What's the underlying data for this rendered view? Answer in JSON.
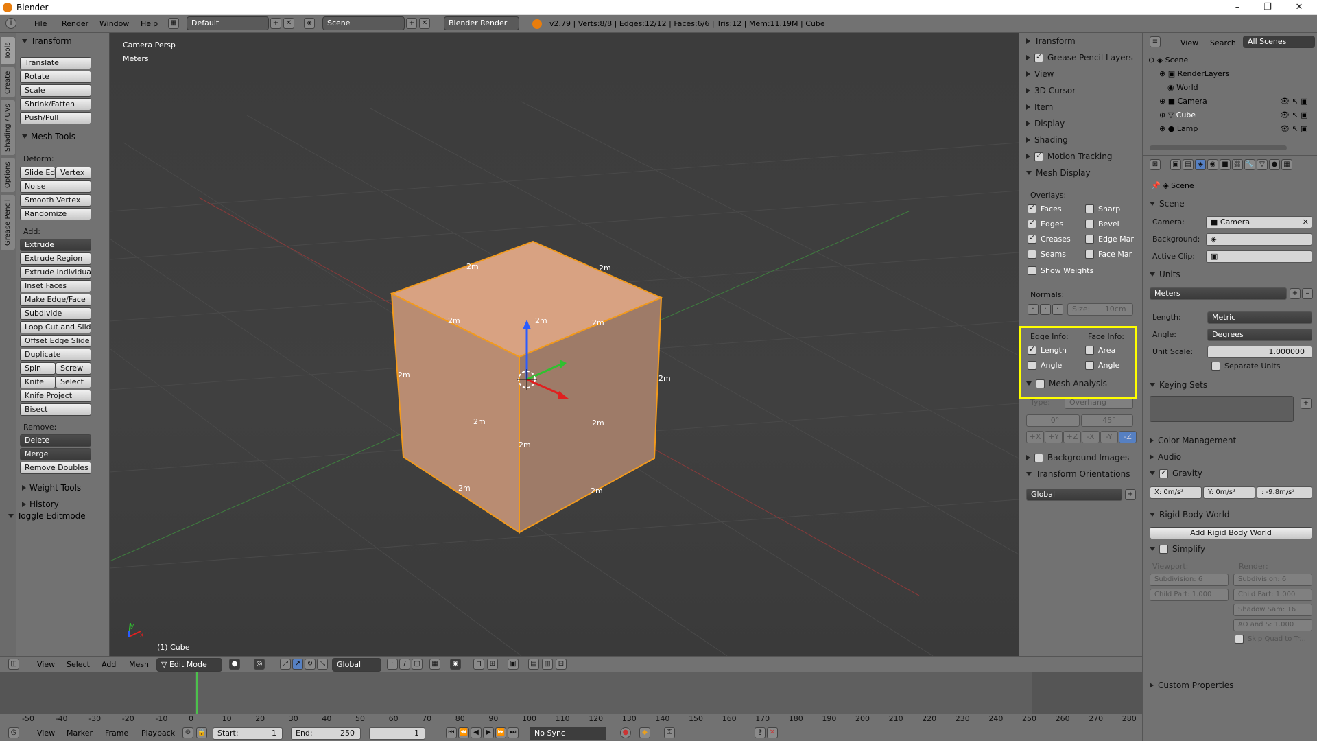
{
  "window": {
    "title": "Blender",
    "minimize": "–",
    "maximize": "❐",
    "close": "✕"
  },
  "menu": {
    "file": "File",
    "render": "Render",
    "window": "Window",
    "help": "Help"
  },
  "header": {
    "screen_layout": "Default",
    "scene": "Scene",
    "engine": "Blender Render",
    "stats": "v2.79 | Verts:8/8 | Edges:12/12 | Faces:6/6 | Tris:12 | Mem:11.19M | Cube"
  },
  "left_tabs": [
    "Tools",
    "Create",
    "Shading / UVs",
    "Options",
    "Grease Pencil"
  ],
  "toolshelf": {
    "transform_header": "Transform",
    "transform_buttons": [
      "Translate",
      "Rotate",
      "Scale",
      "Shrink/Fatten",
      "Push/Pull"
    ],
    "mesh_tools_header": "Mesh Tools",
    "deform_label": "Deform:",
    "slide_edge": "Slide Ed",
    "vertex": "Vertex",
    "noise": "Noise",
    "smooth_vertex": "Smooth Vertex",
    "randomize": "Randomize",
    "add_label": "Add:",
    "extrude": "Extrude",
    "extrude_region": "Extrude Region",
    "extrude_individual": "Extrude Individual",
    "inset_faces": "Inset Faces",
    "make_edge_face": "Make Edge/Face",
    "subdivide": "Subdivide",
    "loop_cut": "Loop Cut and Slide",
    "offset_edge": "Offset Edge Slide",
    "duplicate": "Duplicate",
    "spin": "Spin",
    "screw": "Screw",
    "knife": "Knife",
    "select": "Select",
    "knife_project": "Knife Project",
    "bisect": "Bisect",
    "remove_label": "Remove:",
    "delete": "Delete",
    "merge": "Merge",
    "remove_doubles": "Remove Doubles",
    "weight_tools": "Weight Tools",
    "history": "History",
    "toggle_editmode": "Toggle Editmode"
  },
  "viewport": {
    "view_name": "Camera Persp",
    "units": "Meters",
    "object_label": "(1) Cube",
    "edge_length": "2m",
    "axis_y": "y",
    "axis_x": "x"
  },
  "npanel": {
    "transform": "Transform",
    "grease_pencil_layers": "Grease Pencil Layers",
    "view": "View",
    "cursor_3d": "3D Cursor",
    "item": "Item",
    "display": "Display",
    "shading": "Shading",
    "motion_tracking": "Motion Tracking",
    "mesh_display": "Mesh Display",
    "overlays": "Overlays:",
    "faces": "Faces",
    "sharp": "Sharp",
    "edges": "Edges",
    "bevel": "Bevel",
    "creases": "Creases",
    "edge_mar": "Edge Mar",
    "seams": "Seams",
    "face_mar": "Face Mar",
    "show_weights": "Show Weights",
    "normals": "Normals:",
    "size": "Size:",
    "size_value": "10cm",
    "edge_info": "Edge Info:",
    "face_info": "Face Info:",
    "length": "Length",
    "area": "Area",
    "angle": "Angle",
    "face_angle": "Angle",
    "mesh_analysis": "Mesh Analysis",
    "type_label": "Type:",
    "type_value": "Overhang",
    "min_val": "0°",
    "max_val": "45°",
    "axes": [
      "+X",
      "+Y",
      "+Z",
      "-X",
      "-Y",
      "-Z"
    ],
    "background_images": "Background Images",
    "transform_orientations": "Transform Orientations",
    "global": "Global"
  },
  "outliner": {
    "view": "View",
    "search": "Search",
    "all_scenes": "All Scenes",
    "items": [
      "Scene",
      "RenderLayers",
      "World",
      "Camera",
      "Cube",
      "Lamp"
    ]
  },
  "properties": {
    "breadcrumb": "Scene",
    "scene_header": "Scene",
    "camera_label": "Camera:",
    "camera_value": "Camera",
    "background_label": "Background:",
    "active_clip_label": "Active Clip:",
    "units_header": "Units",
    "units_preset": "Meters",
    "length_label": "Length:",
    "length_value": "Metric",
    "angle_label": "Angle:",
    "angle_value": "Degrees",
    "unit_scale_label": "Unit Scale:",
    "unit_scale_value": "1.000000",
    "separate_units": "Separate Units",
    "keying_sets": "Keying Sets",
    "color_management": "Color Management",
    "audio": "Audio",
    "gravity": "Gravity",
    "gx": "X:  0m/s²",
    "gy": "Y:  0m/s²",
    "gz": ": -9.8m/s²",
    "rigid_body_world": "Rigid Body World",
    "add_rigid_body_world": "Add Rigid Body World",
    "simplify": "Simplify",
    "viewport_label": "Viewport:",
    "render_label": "Render:",
    "subdivision": "Subdivision:",
    "subdivision_value": "6",
    "child_part": "Child Part: 1.000",
    "shadow_sam": "Shadow Sam: 16",
    "ao_and_s": "AO and S: 1.000",
    "skip_quad": "Skip Quad to Tr...",
    "custom_properties": "Custom Properties"
  },
  "vheader": {
    "view": "View",
    "select": "Select",
    "add": "Add",
    "mesh": "Mesh",
    "mode": "Edit Mode",
    "orientation": "Global"
  },
  "timeline": {
    "ticks": [
      "-50",
      "-40",
      "-30",
      "-20",
      "-10",
      "0",
      "10",
      "20",
      "30",
      "40",
      "50",
      "60",
      "70",
      "80",
      "90",
      "100",
      "110",
      "120",
      "130",
      "140",
      "150",
      "160",
      "170",
      "180",
      "190",
      "200",
      "210",
      "220",
      "230",
      "240",
      "250",
      "260",
      "270",
      "280"
    ],
    "view": "View",
    "marker": "Marker",
    "frame": "Frame",
    "playback": "Playback",
    "start": "Start:",
    "start_value": "1",
    "end": "End:",
    "end_value": "250",
    "current": "1",
    "sync": "No Sync"
  }
}
